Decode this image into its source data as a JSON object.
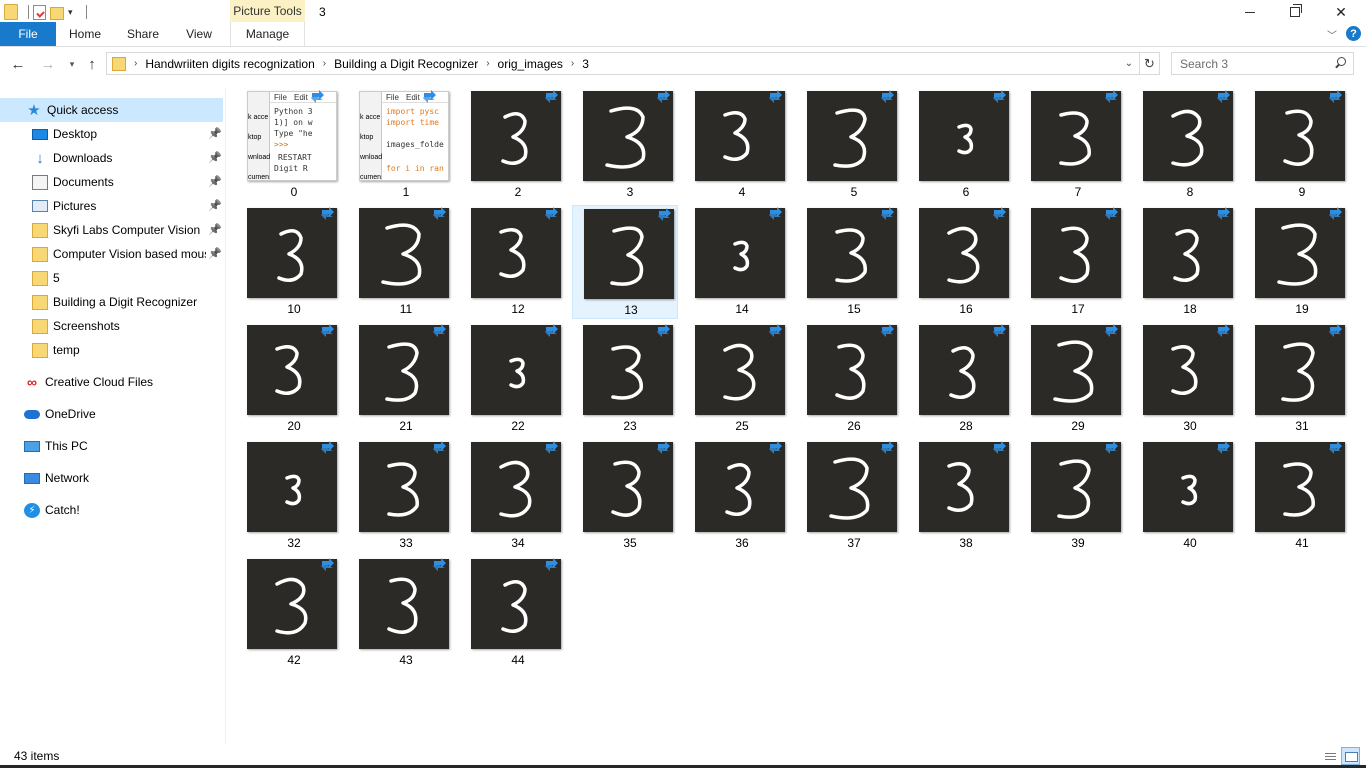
{
  "window": {
    "title": "3",
    "contextual_tab_group": "Picture Tools"
  },
  "ribbon": {
    "tabs": [
      "File",
      "Home",
      "Share",
      "View",
      "Manage"
    ]
  },
  "address": {
    "crumbs": [
      "Handwriiten digits recognization",
      "Building a Digit Recognizer",
      "orig_images",
      "3"
    ],
    "search_placeholder": "Search 3"
  },
  "sidebar": {
    "items": [
      {
        "label": "Quick access",
        "icon": "star-icon",
        "pinned": false,
        "selected": true
      },
      {
        "label": "Desktop",
        "icon": "desktop-icon",
        "pinned": true
      },
      {
        "label": "Downloads",
        "icon": "download-icon",
        "pinned": true
      },
      {
        "label": "Documents",
        "icon": "documents-icon",
        "pinned": true
      },
      {
        "label": "Pictures",
        "icon": "pictures-icon",
        "pinned": true
      },
      {
        "label": "Skyfi Labs Computer Vision",
        "icon": "folder-icon",
        "pinned": true
      },
      {
        "label": "Computer Vision based mous",
        "icon": "folder-icon",
        "pinned": true
      },
      {
        "label": "5",
        "icon": "folder-icon",
        "pinned": false
      },
      {
        "label": "Building a Digit Recognizer",
        "icon": "folder-icon",
        "pinned": false
      },
      {
        "label": "Screenshots",
        "icon": "folder-icon",
        "pinned": false
      },
      {
        "label": "temp",
        "icon": "folder-icon",
        "pinned": false
      },
      {
        "label": "Creative Cloud Files",
        "icon": "creative-cloud-icon",
        "pinned": false
      },
      {
        "label": "OneDrive",
        "icon": "onedrive-icon",
        "pinned": false
      },
      {
        "label": "This PC",
        "icon": "this-pc-icon",
        "pinned": false
      },
      {
        "label": "Network",
        "icon": "network-icon",
        "pinned": false
      },
      {
        "label": "Catch!",
        "icon": "catch-icon",
        "pinned": false
      }
    ]
  },
  "files": [
    {
      "name": "0",
      "kind": "code"
    },
    {
      "name": "1",
      "kind": "code"
    },
    {
      "name": "2"
    },
    {
      "name": "3"
    },
    {
      "name": "4"
    },
    {
      "name": "5"
    },
    {
      "name": "6"
    },
    {
      "name": "7"
    },
    {
      "name": "8"
    },
    {
      "name": "9"
    },
    {
      "name": "10"
    },
    {
      "name": "11"
    },
    {
      "name": "12"
    },
    {
      "name": "13",
      "selected": true
    },
    {
      "name": "14"
    },
    {
      "name": "15"
    },
    {
      "name": "16"
    },
    {
      "name": "17"
    },
    {
      "name": "18"
    },
    {
      "name": "19"
    },
    {
      "name": "20"
    },
    {
      "name": "21"
    },
    {
      "name": "22"
    },
    {
      "name": "23"
    },
    {
      "name": "25"
    },
    {
      "name": "26"
    },
    {
      "name": "28"
    },
    {
      "name": "29"
    },
    {
      "name": "30"
    },
    {
      "name": "31"
    },
    {
      "name": "32"
    },
    {
      "name": "33"
    },
    {
      "name": "34"
    },
    {
      "name": "35"
    },
    {
      "name": "36"
    },
    {
      "name": "37"
    },
    {
      "name": "38"
    },
    {
      "name": "39"
    },
    {
      "name": "40"
    },
    {
      "name": "41"
    },
    {
      "name": "42"
    },
    {
      "name": "43"
    },
    {
      "name": "44"
    }
  ],
  "code_thumbs": [
    {
      "menu": [
        "File",
        "Edit"
      ],
      "sidebar_text": [
        "k acce",
        "ktop",
        "wnload",
        "cumen"
      ],
      "lines": [
        "Python 3",
        "1)] on w",
        "Type \"he",
        ">>>",
        "RESTART",
        "Digit R"
      ]
    },
    {
      "menu": [
        "File",
        "Edit"
      ],
      "sidebar_text": [
        "k acce",
        "ktop",
        "wnload",
        "cumen"
      ],
      "lines": [
        "import pysc",
        "import time",
        "images_folde",
        "for i in ran"
      ]
    }
  ],
  "status": {
    "item_count": "43 items"
  },
  "colors": {
    "accent": "#1979ca",
    "selection": "#cce8ff",
    "thumbnail_bg": "#2b2a26",
    "digit_stroke": "#ffffff",
    "sync_badge": "#2f8ee0"
  }
}
